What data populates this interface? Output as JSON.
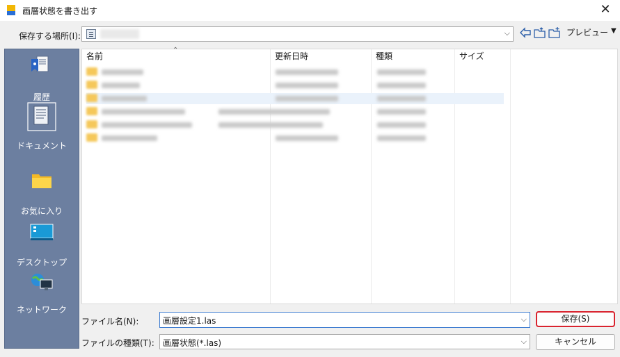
{
  "window": {
    "title": "画層状態を書き出す",
    "close_glyph": "✕"
  },
  "toolbar": {
    "save_in_label": "保存する場所(I):",
    "save_in_value_icon": "document-folder-icon",
    "combo_arrow": "⌵",
    "nav_icons": [
      "back-arrow-icon",
      "up-folder-icon",
      "new-folder-icon"
    ],
    "preview_label": "プレビュー",
    "preview_arrow": "▼"
  },
  "places": [
    {
      "label": "履歴",
      "icon": "history-icon"
    },
    {
      "label": "ドキュメント",
      "icon": "documents-icon"
    },
    {
      "label": "お気に入り",
      "icon": "favorites-folder-icon"
    },
    {
      "label": "デスクトップ",
      "icon": "desktop-icon"
    },
    {
      "label": "ネットワーク",
      "icon": "network-icon"
    }
  ],
  "file_list": {
    "sort_caret": "⌃",
    "columns": [
      "名前",
      "更新日時",
      "種類",
      "サイズ"
    ],
    "row_count_blurred": 6
  },
  "form": {
    "filename_label": "ファイル名(N):",
    "filename_value": "画層設定1.las",
    "filetype_label": "ファイルの種類(T):",
    "filetype_value": "画層状態(*.las)",
    "dropdown_arrow": "⌵"
  },
  "buttons": {
    "save": "保存(S)",
    "cancel": "キャンセル"
  },
  "colors": {
    "places_bar": "#6c7fa0",
    "highlight_border": "#d9232e",
    "input_focus": "#3c7bd0"
  }
}
